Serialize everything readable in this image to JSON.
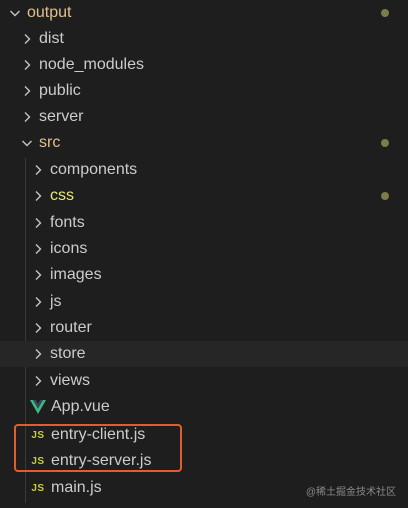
{
  "explorer": {
    "root": {
      "label": "output",
      "icon": "chevron-down-icon",
      "modified": true
    },
    "level1": [
      {
        "label": "dist",
        "icon": "chevron-right-icon"
      },
      {
        "label": "node_modules",
        "icon": "chevron-right-icon"
      },
      {
        "label": "public",
        "icon": "chevron-right-icon"
      },
      {
        "label": "server",
        "icon": "chevron-right-icon"
      }
    ],
    "src": {
      "label": "src",
      "icon": "chevron-down-icon",
      "modified": true
    },
    "src_children": [
      {
        "label": "components",
        "icon": "chevron-right-icon"
      },
      {
        "label": "css",
        "icon": "chevron-right-icon",
        "modified": true
      },
      {
        "label": "fonts",
        "icon": "chevron-right-icon"
      },
      {
        "label": "icons",
        "icon": "chevron-right-icon"
      },
      {
        "label": "images",
        "icon": "chevron-right-icon"
      },
      {
        "label": "js",
        "icon": "chevron-right-icon"
      },
      {
        "label": "router",
        "icon": "chevron-right-icon"
      },
      {
        "label": "store",
        "icon": "chevron-right-icon",
        "selected": true
      },
      {
        "label": "views",
        "icon": "chevron-right-icon"
      }
    ],
    "src_files": [
      {
        "label": "App.vue",
        "icon": "vue-icon"
      },
      {
        "label": "entry-client.js",
        "icon": "js-file-icon",
        "icon_text": "JS",
        "highlighted": true
      },
      {
        "label": "entry-server.js",
        "icon": "js-file-icon",
        "icon_text": "JS",
        "highlighted": true
      },
      {
        "label": "main.js",
        "icon": "js-file-icon",
        "icon_text": "JS"
      }
    ]
  },
  "watermark": "@稀土掘金技术社区",
  "colors": {
    "background": "#1e1e1e",
    "text": "#cccccc",
    "modified_folder": "#e2c08d",
    "js_icon": "#cbcb41",
    "vue_icon": "#41b883",
    "highlight_box": "#e35c2e"
  }
}
